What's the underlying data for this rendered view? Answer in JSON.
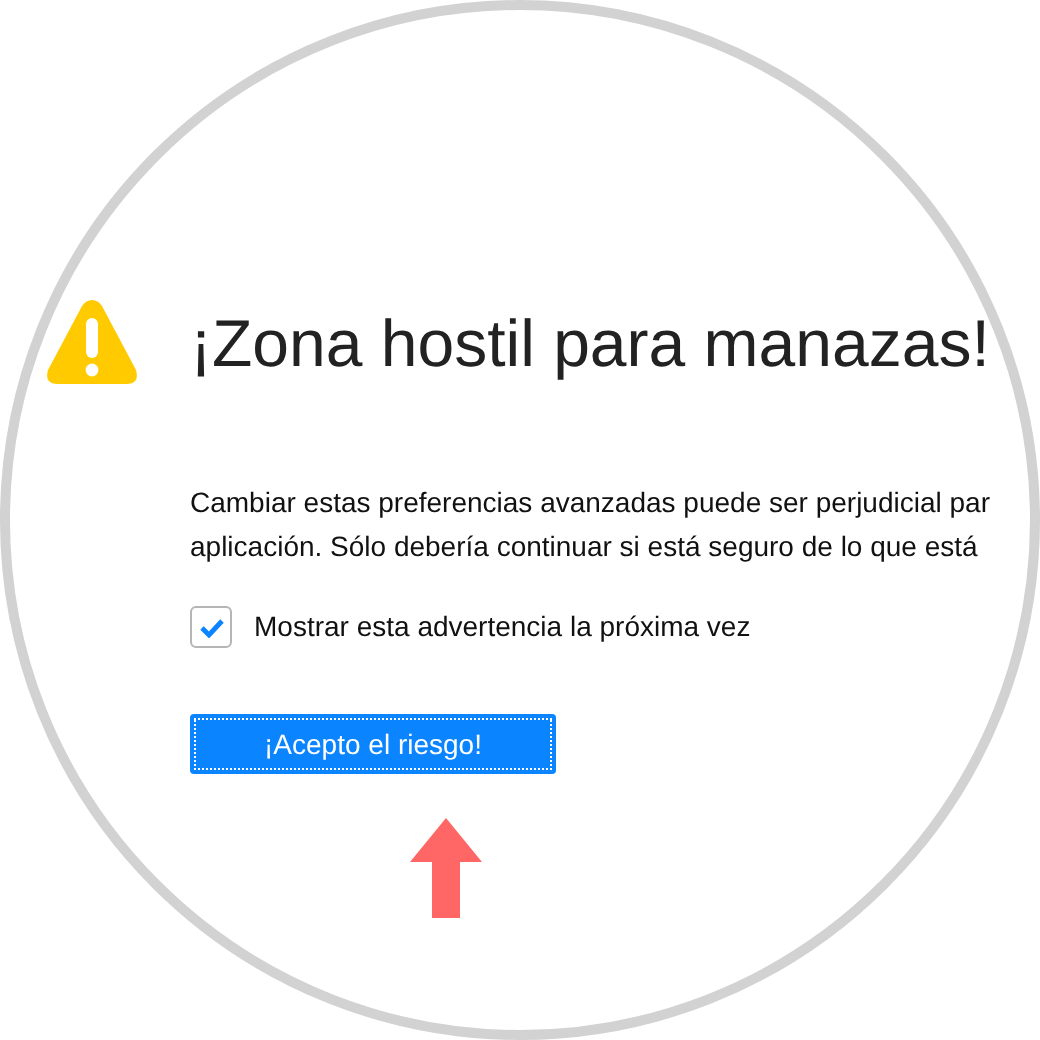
{
  "title": "¡Zona hostil para manazas!",
  "message_lines": [
    "Cambiar estas preferencias avanzadas puede ser perjudicial par",
    "aplicación. Sólo debería continuar si está seguro de lo que está"
  ],
  "checkbox": {
    "label": "Mostrar esta advertencia la próxima vez",
    "checked": true
  },
  "button": {
    "label": "¡Acepto el riesgo!"
  }
}
